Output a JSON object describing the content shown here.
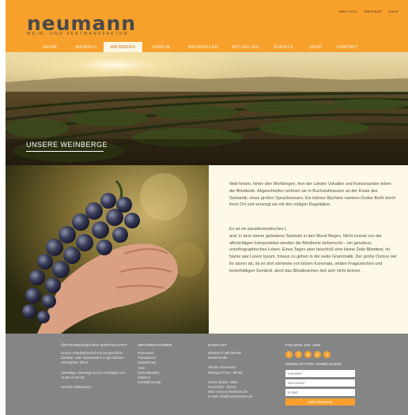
{
  "brand": {
    "name": "neumann",
    "subtitle": "WEIN- UND SEKTMANUFAKTUR"
  },
  "top_links": [
    "Mein Konto",
    "Warenkorb",
    "Kasse"
  ],
  "nav": {
    "items": [
      "HOME",
      "WEINGUT",
      "WEINBERG",
      "FAMILIE",
      "WEINKELLER",
      "AKTUELLES",
      "EVENTS",
      "SHOP",
      "KONTAKT"
    ],
    "active": "WEINBERG"
  },
  "hero": {
    "title": "UNSERE WEINBERGE"
  },
  "content": {
    "para1": "Weit hinten, hinter den Wortbergen, fern der Länder Vokalien und Konsonantien leben die Blindtexte. Abgeschieden wohnen sie in Buchstabhausen an der Küste des Semantik, eines großen Sprachozeans. Ein kleines Bächlein namens Duden fließt durch ihren Ort und versorgt sie mit den nötigen Regelialien.",
    "para2_intro": "Es ist ein paradiesmatisches L",
    "para2": "and, in dem einem gebratene Satzteile in den Mund fliegen. Nicht einmal von der allmächtigen Interpunktion werden die Blindtexte beherrscht – ein geradezu unorthographisches Leben. Eines Tages aber beschloß eine kleine Zeile Blindtext, ihr Name war Lorem Ipsum, hinaus zu gehen in die weite Grammatik. Der große Oxmox riet ihr davon ab, da es dort wimmele von bösen Kommata, wilden Fragezeichen und hinterhältigen Semikoli, doch das Blindtextchen ließ sich nicht beirren."
  },
  "footer": {
    "hours": {
      "heading": "ÖFFNUNGSZEITEN WIRTSCHAFT",
      "line1": "Unsere Straußwirtschaft mit zeitgemäßem Zweiklar- oder Speisekarten in gemütlicher Atmosphäre öffnet",
      "line2": "Samstags, Sonntags und an Feiertagen von 11:00-14:00 Uhr",
      "line3": "Herzlich willkommen"
    },
    "info": {
      "heading": "INFORMATIONEN",
      "links": [
        "Impressum",
        "Transparenz",
        "Datenschutz",
        "AGB",
        "Versandkosten",
        "Widerruf",
        "Kontaktformular"
      ]
    },
    "contact": {
      "heading": "KONTAKT",
      "name1": "WEINGUT NEUMANN",
      "name2": "Musterstraße",
      "phone1": "Telefon sonnenarm",
      "phone2": "Weingut 07234 - 88788",
      "fax1": "Fonen 35432 - 5900",
      "fax2": "Fax 07345 - 32143",
      "web": "Web: www.m-rheinheim.de",
      "email": "E-Mail: info@musternamen.de"
    },
    "social": {
      "heading": "FOLGEN SIE UNS",
      "icons": [
        {
          "name": "facebook-icon",
          "glyph": "f"
        },
        {
          "name": "twitter-icon",
          "glyph": "t"
        },
        {
          "name": "googleplus-icon",
          "glyph": "g"
        },
        {
          "name": "pinterest-icon",
          "glyph": "p"
        },
        {
          "name": "xing-icon",
          "glyph": "x"
        }
      ]
    },
    "newsletter": {
      "heading": "NEWSLETTER-ANMELDUNG",
      "firstname_placeholder": "Vorname*",
      "lastname_placeholder": "Nachname*",
      "email_placeholder": "E-Mail*",
      "button": "Jetzt abonnieren"
    }
  },
  "colors": {
    "brand_orange": "#f7a12c",
    "footer_gray": "#858585",
    "text_bg": "#fef9e6"
  }
}
